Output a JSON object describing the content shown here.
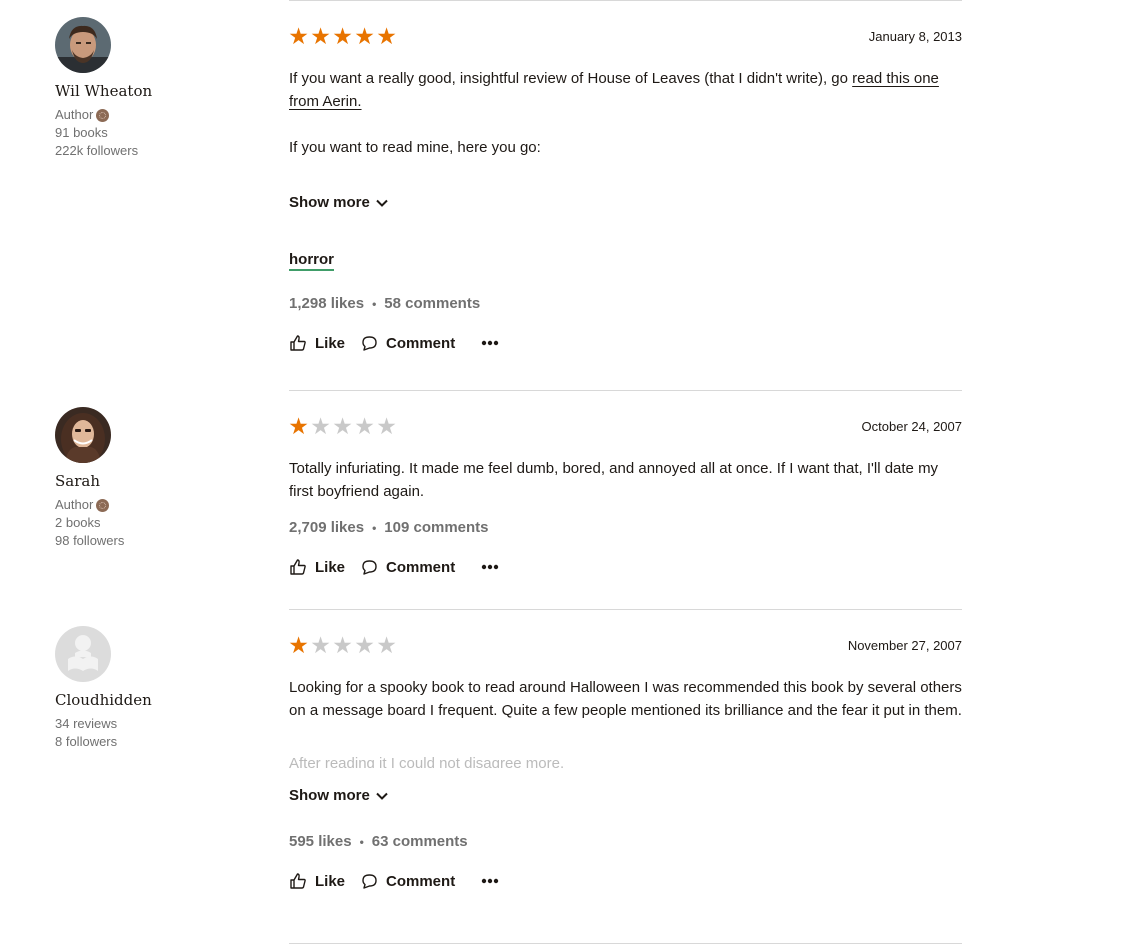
{
  "reviews": [
    {
      "reviewer": {
        "name": "Wil Wheaton",
        "author_label": "Author",
        "books": "91 books",
        "followers": "222k followers"
      },
      "rating": 5,
      "date": "January 8, 2013",
      "text_before_link": "If you want a really good, insightful review of House of Leaves (that I didn't write), go ",
      "link_text": "read this one from Aerin.",
      "paragraph2": "If you want to read mine, here you go:",
      "show_more": "Show more",
      "tag": "horror",
      "likes": "1,298 likes",
      "comments": "58 comments",
      "actions": {
        "like": "Like",
        "comment": "Comment"
      }
    },
    {
      "reviewer": {
        "name": "Sarah",
        "author_label": "Author",
        "books": "2 books",
        "followers": "98 followers"
      },
      "rating": 1,
      "date": "October 24, 2007",
      "text": "Totally infuriating. It made me feel dumb, bored, and annoyed all at once. If I want that, I'll date my first boyfriend again.",
      "likes": "2,709 likes",
      "comments": "109 comments",
      "actions": {
        "like": "Like",
        "comment": "Comment"
      }
    },
    {
      "reviewer": {
        "name": "Cloudhidden",
        "reviews": "34 reviews",
        "followers": "8 followers"
      },
      "rating": 1,
      "date": "November 27, 2007",
      "text": "Looking for a spooky book to read around Halloween I was recommended this book by several others on a message board I frequent. Quite a few people mentioned its brilliance and the fear it put in them.",
      "faded_text": "After reading it I could not disagree more.",
      "show_more": "Show more",
      "likes": "595 likes",
      "comments": "63 comments",
      "actions": {
        "like": "Like",
        "comment": "Comment"
      }
    }
  ],
  "colors": {
    "star_on": "#e87400",
    "star_off": "#c9c9c9",
    "tag_underline": "#409d69",
    "muted": "#707070"
  }
}
